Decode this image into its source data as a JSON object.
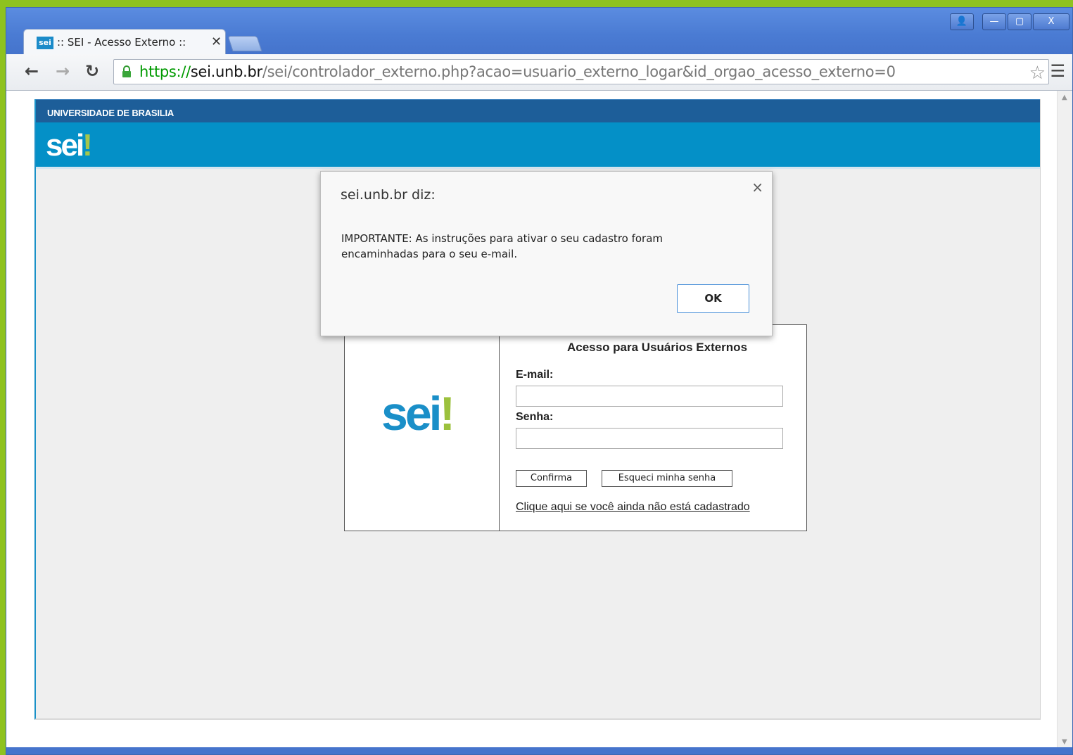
{
  "browser": {
    "tab_title": ":: SEI - Acesso Externo ::",
    "tab_favicon": "sei",
    "tab_close": "✕",
    "url_scheme": "https://",
    "url_host": "sei.unb.br",
    "url_path": "/sei/controlador_externo.php?acao=usuario_externo_logar&id_orgao_acesso_externo=0",
    "controls": {
      "user": "👤",
      "minimize": "—",
      "maximize": "▢",
      "close": "X"
    },
    "icons": {
      "back": "back-arrow-icon",
      "forward": "forward-arrow-icon",
      "reload": "reload-icon",
      "lock": "lock-icon",
      "star": "star-icon",
      "menu": "hamburger-menu-icon"
    }
  },
  "page": {
    "university": "UNIVERSIDADE DE BRASILIA",
    "header_logo": "sei",
    "header_logo_bang": "!"
  },
  "login": {
    "logo": "sei",
    "logo_bang": "!",
    "title": "Acesso para Usuários Externos",
    "email_label": "E-mail:",
    "email_value": "",
    "senha_label": "Senha:",
    "senha_value": "",
    "confirm_button": "Confirma",
    "forgot_button": "Esqueci minha senha",
    "register_link": "Clique aqui se você ainda não está cadastrado"
  },
  "dialog": {
    "title": "sei.unb.br diz:",
    "message": "IMPORTANTE: As instruções para ativar o seu cadastro foram encaminhadas para o seu e-mail.",
    "ok_button": "OK",
    "close": "×"
  },
  "colors": {
    "frame": "#8ec21f",
    "university_bar": "#1d5e99",
    "sei_header": "#0490c7",
    "sei_blue": "#1a8fc8",
    "sei_green": "#9cc13d"
  }
}
